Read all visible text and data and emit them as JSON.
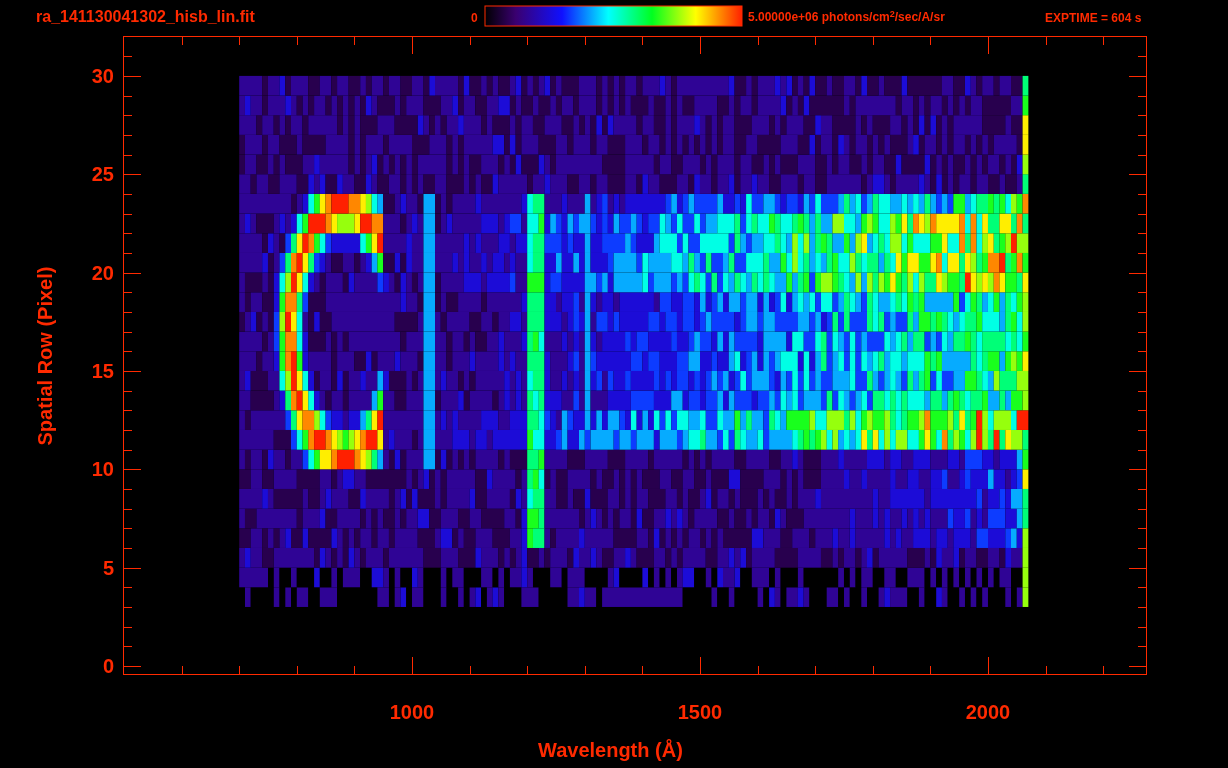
{
  "title": "ra_141130041302_hisb_lin.fit",
  "colorbar": {
    "min_label": "0",
    "max_label": "5.00000e+06 photons/cm$^{2}$/sec/A/sr"
  },
  "exposure": "EXPTIME = 604 s",
  "y_axis": {
    "label": "Spatial Row (Pixel)",
    "ticks": [
      "30",
      "25",
      "20",
      "15",
      "10",
      "5",
      "0"
    ]
  },
  "x_axis": {
    "label": "Wavelength (Å)",
    "ticks": [
      "1000",
      "1500",
      "2000"
    ]
  }
}
